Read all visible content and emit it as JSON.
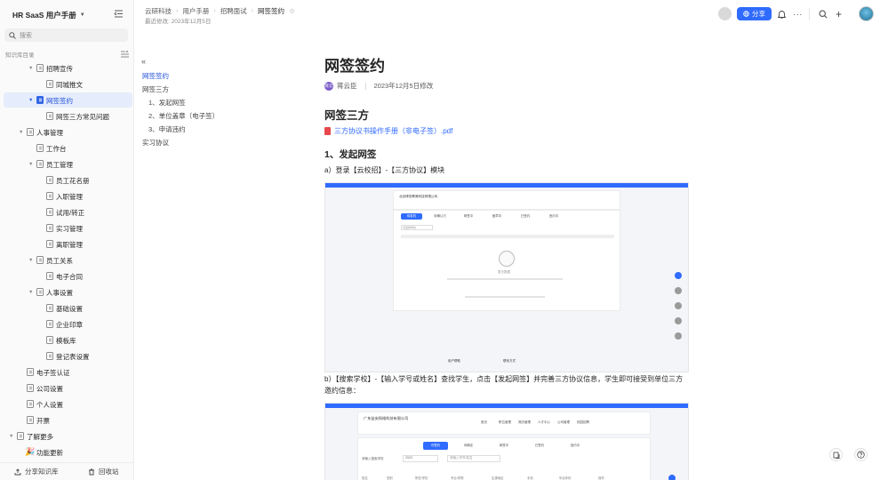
{
  "sidebar": {
    "space_title": "HR SaaS 用户手册",
    "search_placeholder": "搜索",
    "toc_title": "知识库目录",
    "items": [
      {
        "label": "招聘宣传"
      },
      {
        "label": "同城推文"
      },
      {
        "label": "网签签约"
      },
      {
        "label": "网签三方常见问题"
      },
      {
        "label": "人事管理"
      },
      {
        "label": "工作台"
      },
      {
        "label": "员工管理"
      },
      {
        "label": "员工花名册"
      },
      {
        "label": "入职管理"
      },
      {
        "label": "试用/转正"
      },
      {
        "label": "实习管理"
      },
      {
        "label": "离职管理"
      },
      {
        "label": "员工关系"
      },
      {
        "label": "电子合同"
      },
      {
        "label": "人事设置"
      },
      {
        "label": "基础设置"
      },
      {
        "label": "企业印章"
      },
      {
        "label": "模板库"
      },
      {
        "label": "登记表设置"
      },
      {
        "label": "电子签认证"
      },
      {
        "label": "公司设置"
      },
      {
        "label": "个人设置"
      },
      {
        "label": "开票"
      },
      {
        "label": "了解更多"
      },
      {
        "label": "功能更新"
      }
    ],
    "footer": {
      "share": "分享知识库",
      "trash": "回收站"
    }
  },
  "topbar": {
    "breadcrumb": [
      "云研科技",
      "用户手册",
      "招聘面试",
      "网签签约"
    ],
    "last_modified": "最近修改: 2023年12月5日",
    "share_label": "分享"
  },
  "outline": {
    "items": [
      "网签签约",
      "网签三方",
      "1、发起网签",
      "2、单位盖章（电子签）",
      "3、申请违约",
      "实习协议"
    ]
  },
  "document": {
    "title": "网签签约",
    "author": "蒋云臣",
    "author_avatar": "蒋云",
    "modified": "2023年12月5日修改",
    "section_title": "网签三方",
    "pdf_link": "三方协议书操作手册（非电子签）.pdf",
    "step1_title": "1、发起网签",
    "step_a": "a）登录【云校招】-【三方协议】模块",
    "step_b": "b）【搜索学校】-【输入学号或姓名】查找学生，点击【发起网签】并完善三方协议信息，学生即可接受到单位三方邀约信息：",
    "shot1": {
      "company": "北京博览教育科技有限公司",
      "tabs": [
        "待发约",
        "待确认方",
        "网签中",
        "盖章中",
        "已签约",
        "违约中"
      ],
      "search_school": "请选择学校",
      "empty_text": "暂无数据",
      "footer_labels": [
        "用户帮助",
        "联系方式"
      ]
    },
    "shot2": {
      "company": "广东益安网络科技有限公司",
      "nav": [
        "首页",
        "职位管理",
        "简历管理",
        "人才中心",
        "公司管理",
        "校园招聘"
      ],
      "tabs": [
        "可签约",
        "待确定",
        "网签中",
        "已签约",
        "违约中"
      ],
      "search_school": "请输入搜索学校",
      "year": "2023",
      "name_placeholder": "请输入学号/姓名",
      "columns": [
        "姓名",
        "性别",
        "所在/学历",
        "专业/学院",
        "生源地区",
        "手机",
        "毕业年份",
        "操作"
      ]
    }
  },
  "colors": {
    "accent": "#2f6bff",
    "active_bg": "#e5ecfb",
    "active_text": "#1d4ed8"
  }
}
